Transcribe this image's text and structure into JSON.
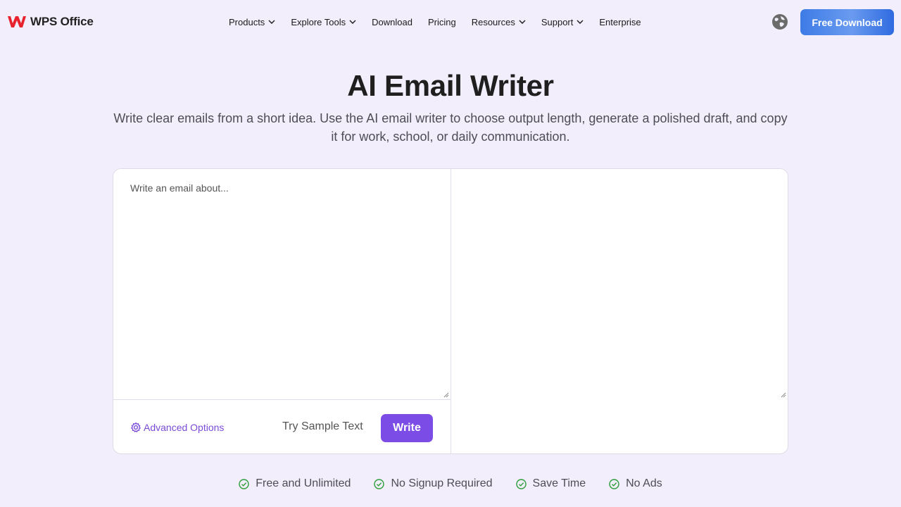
{
  "header": {
    "logo_text": "WPS Office",
    "nav": [
      {
        "label": "Products",
        "dropdown": true
      },
      {
        "label": "Explore Tools",
        "dropdown": true
      },
      {
        "label": "Download",
        "dropdown": false
      },
      {
        "label": "Pricing",
        "dropdown": false
      },
      {
        "label": "Resources",
        "dropdown": true
      },
      {
        "label": "Support",
        "dropdown": true
      },
      {
        "label": "Enterprise",
        "dropdown": false
      }
    ],
    "cta_label": "Free Download",
    "icons": {
      "logo": "wps-logo-icon",
      "language": "globe-icon",
      "dropdown": "chevron-down-icon"
    }
  },
  "hero": {
    "title": "AI Email Writer",
    "subtitle": "Write clear emails from a short idea. Use the AI email writer to choose output length, generate a polished draft, and copy it for work, school, or daily communication."
  },
  "tool": {
    "input_placeholder": "Write an email about...",
    "input_value": "",
    "output_value": "",
    "advanced_label": "Advanced Options",
    "sample_label": "Try Sample Text",
    "write_label": "Write"
  },
  "features": [
    {
      "label": "Free and Unlimited"
    },
    {
      "label": "No Signup Required"
    },
    {
      "label": "Save Time"
    },
    {
      "label": "No Ads"
    }
  ],
  "colors": {
    "background": "#f2eefb",
    "accent_purple": "#7c4de6",
    "cta_blue": "#3d7be6",
    "check_green": "#2e9d3a",
    "brand_red": "#e8232d"
  }
}
